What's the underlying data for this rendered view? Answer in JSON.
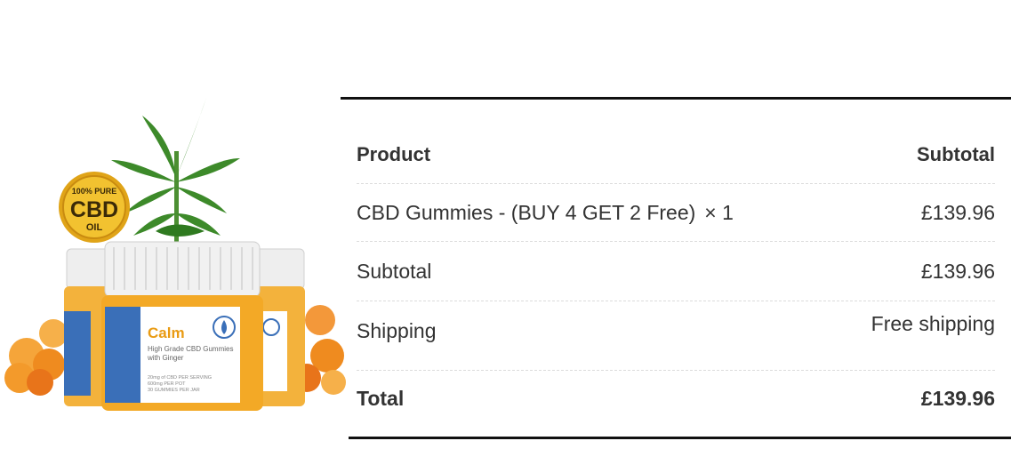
{
  "product_image": {
    "badge": {
      "line1": "100% PURE",
      "line2": "CBD",
      "line3": "OIL"
    },
    "jar_label": {
      "name": "Calm",
      "subtitle_line1": "High Grade CBD Gummies",
      "subtitle_line2": "with Ginger",
      "detail_line1": "20mg of CBD PER SERVING",
      "detail_line2": "600mg PER POT",
      "detail_line3": "30 GUMMIES PER JAR"
    },
    "icons": {
      "plant": "cannabis-leaf-icon",
      "badge": "gold-seal-icon",
      "brand": "leaf-circle-logo-icon"
    },
    "colors": {
      "gold": "#e0a418",
      "label_orange": "#e99b13",
      "label_blue": "#3a6fb8",
      "leaf_green": "#3d8a2a",
      "gummy": "#f08a1e"
    }
  },
  "order_table": {
    "header": {
      "product": "Product",
      "subtotal": "Subtotal"
    },
    "items": [
      {
        "name": "CBD Gummies - (BUY 4 GET 2 Free)",
        "quantity": "× 1",
        "subtotal": "£139.96"
      }
    ],
    "subtotal": {
      "label": "Subtotal",
      "value": "£139.96"
    },
    "shipping": {
      "label": "Shipping",
      "value": "Free shipping"
    },
    "total": {
      "label": "Total",
      "value": "£139.96"
    }
  }
}
